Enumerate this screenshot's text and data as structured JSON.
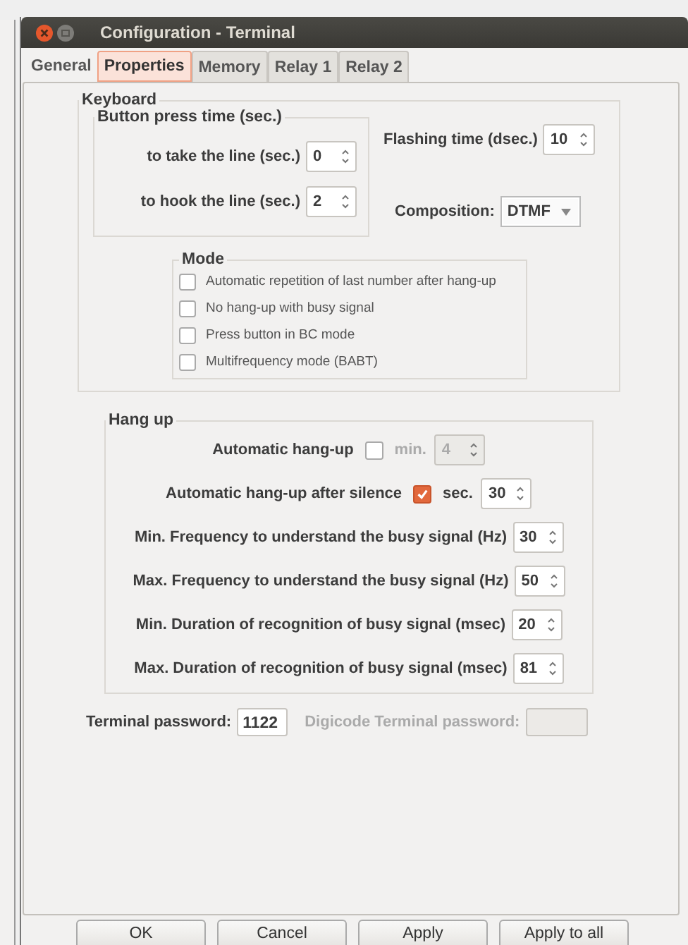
{
  "window": {
    "title": "Configuration - Terminal"
  },
  "tabs": [
    {
      "label": "General",
      "selected": false
    },
    {
      "label": "Properties",
      "selected": true
    },
    {
      "label": "Memory",
      "selected": false
    },
    {
      "label": "Relay 1",
      "selected": false
    },
    {
      "label": "Relay 2",
      "selected": false
    }
  ],
  "keyboard": {
    "title": "Keyboard",
    "button_press": {
      "title": "Button press time (sec.)",
      "fields": [
        {
          "label": "to take the line (sec.)",
          "value": "0"
        },
        {
          "label": "to hook the line (sec.)",
          "value": "2"
        }
      ]
    },
    "flashing": {
      "label": "Flashing time (dsec.)",
      "value": "10"
    },
    "composition": {
      "label": "Composition:",
      "value": "DTMF"
    },
    "mode": {
      "title": "Mode",
      "options": [
        {
          "label": "Automatic repetition of last number after hang-up",
          "checked": false
        },
        {
          "label": "No hang-up with busy signal",
          "checked": false
        },
        {
          "label": "Press button in BC mode",
          "checked": false
        },
        {
          "label": "Multifrequency mode (BABT)",
          "checked": false
        }
      ]
    }
  },
  "hang_up": {
    "title": "Hang up",
    "rows": [
      {
        "kind": "toggle",
        "label": "Automatic hang-up",
        "checked": false,
        "unit": "min.",
        "value": "4",
        "disabled": true
      },
      {
        "kind": "toggle",
        "label": "Automatic hang-up after silence",
        "checked": true,
        "unit": "sec.",
        "value": "30",
        "disabled": false
      },
      {
        "kind": "spin",
        "label": "Min.  Frequency to understand the busy signal (Hz)",
        "value": "30"
      },
      {
        "kind": "spin",
        "label": "Max.  Frequency to understand the busy signal (Hz)",
        "value": "50"
      },
      {
        "kind": "spin",
        "label": "Min. Duration of recognition of busy signal (msec)",
        "value": "20"
      },
      {
        "kind": "spin",
        "label": "Max. Duration of recognition of busy signal (msec)",
        "value": "81"
      }
    ]
  },
  "passwords": [
    {
      "label": "Terminal password:",
      "value": "1122",
      "disabled": false
    },
    {
      "label": "Digicode Terminal password:",
      "disabled": true
    }
  ],
  "buttons": [
    "OK",
    "Cancel",
    "Apply",
    "Apply to all"
  ]
}
